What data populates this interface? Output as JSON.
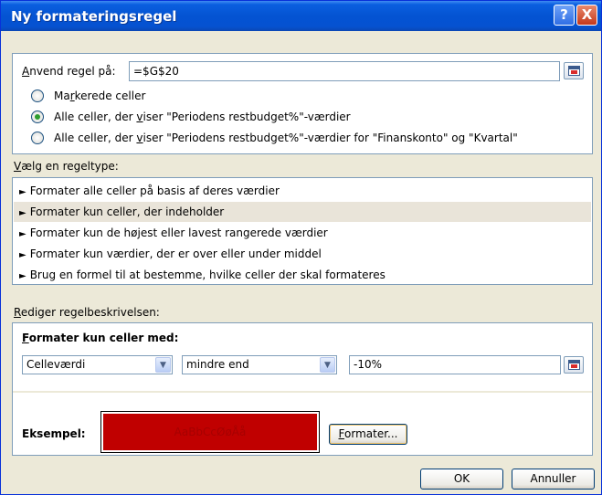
{
  "dialog": {
    "title": "Ny formateringsregel",
    "help_glyph": "?",
    "close_glyph": "X"
  },
  "apply_rule": {
    "label_accel": "A",
    "label_rest": "nvend regel på:",
    "value": "=$G$20"
  },
  "scope_options": [
    {
      "pre": "Ma",
      "accel": "r",
      "post": "kerede celler",
      "checked": false
    },
    {
      "pre": "Alle celler, der ",
      "accel": "v",
      "post": "iser \"Periodens restbudget%\"-værdier",
      "checked": true
    },
    {
      "pre": "Alle celler, der ",
      "accel": "v",
      "post": "iser \"Periodens restbudget%\"-værdier for \"Finanskonto\" og \"Kvartal\"",
      "checked": false
    }
  ],
  "rule_type": {
    "label_accel": "V",
    "label_rest": "ælg en regeltype:",
    "arrow_glyph": "►",
    "items": [
      {
        "label": "Formater alle celler på basis af deres værdier",
        "selected": false
      },
      {
        "label": "Formater kun celler, der indeholder",
        "selected": true
      },
      {
        "label": "Formater kun de højest eller lavest rangerede værdier",
        "selected": false
      },
      {
        "label": "Formater kun værdier, der er over eller under middel",
        "selected": false
      },
      {
        "label": "Brug en formel til at bestemme, hvilke celler der skal formateres",
        "selected": false
      }
    ]
  },
  "edit_desc": {
    "label_accel": "R",
    "label_rest": "ediger regelbeskrivelsen:",
    "format_only_accel": "F",
    "format_only_rest": "ormater kun celler med:",
    "condition_field": "Celleværdi",
    "operator": "mindre end",
    "value": "-10%",
    "dropdown_glyph": "▼"
  },
  "preview": {
    "label": "Eksempel:",
    "sample_text": "AaBbCcØøÅå",
    "fill_color": "#c00000",
    "text_color": "#a60000"
  },
  "buttons": {
    "format_accel": "F",
    "format_rest": "ormater...",
    "ok": "OK",
    "cancel": "Annuller"
  },
  "colors": {
    "titlebar": "#0453d2",
    "dialog_bg": "#ece9d8",
    "border": "#7f9db9",
    "radio_dot": "#2e9d2e"
  }
}
